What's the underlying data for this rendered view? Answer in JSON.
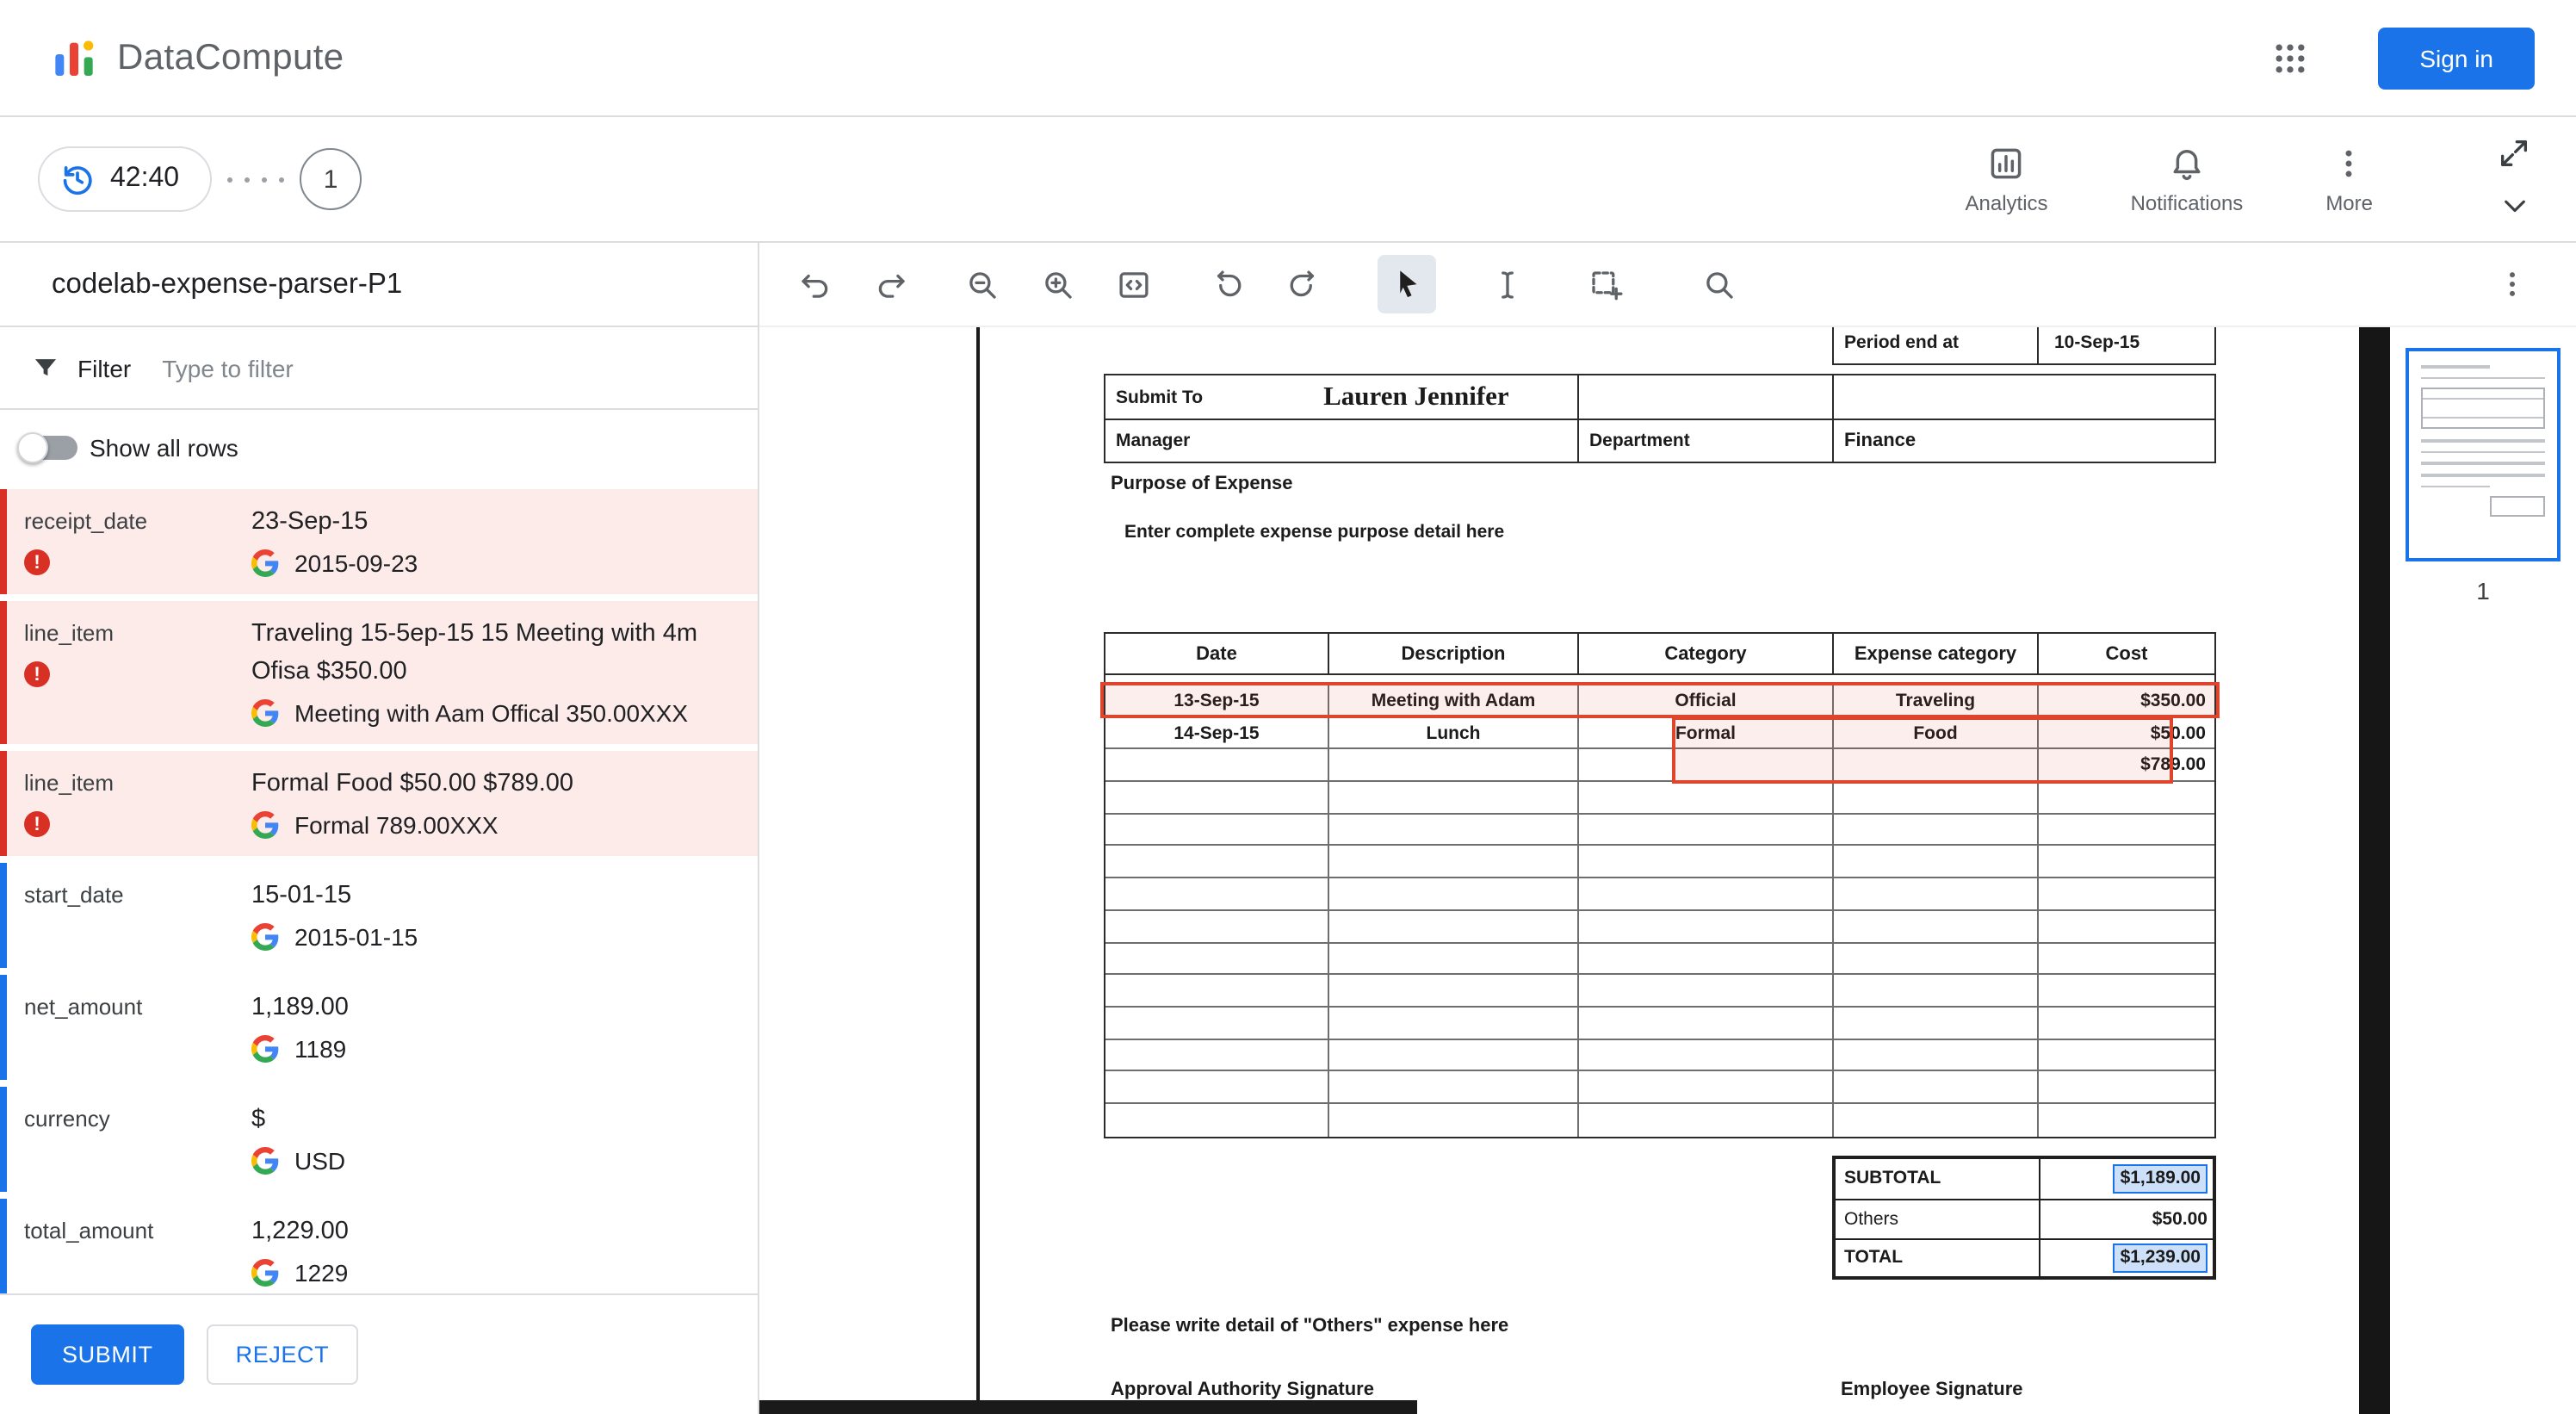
{
  "colors": {
    "accent": "#1a73e8",
    "error": "#d93025",
    "error_bg": "#fcebe9",
    "annotation_red": "#df442d"
  },
  "header": {
    "brand": "DataCompute",
    "sign_in": "Sign in"
  },
  "session_bar": {
    "timer": "42:40",
    "step": "1",
    "actions": [
      {
        "label": "Analytics"
      },
      {
        "label": "Notifications"
      },
      {
        "label": "More"
      }
    ]
  },
  "left_panel": {
    "title": "codelab-expense-parser-P1",
    "filter_label": "Filter",
    "filter_placeholder": "Type to filter",
    "show_all_rows": "Show all rows",
    "fields": [
      {
        "name": "receipt_date",
        "status": "error",
        "value": "23-Sep-15",
        "normalized": "2015-09-23"
      },
      {
        "name": "line_item",
        "status": "error",
        "value": "Traveling 15-5ep-15 15 Meeting with 4m Ofisa $350.00",
        "normalized": "Meeting with Aam Offical 350.00XXX"
      },
      {
        "name": "line_item",
        "status": "error",
        "value": "Formal Food $50.00 $789.00",
        "normalized": "Formal 789.00XXX"
      },
      {
        "name": "start_date",
        "status": "ok",
        "value": "15-01-15",
        "normalized": "2015-01-15"
      },
      {
        "name": "net_amount",
        "status": "ok",
        "value": "1,189.00",
        "normalized": "1189"
      },
      {
        "name": "currency",
        "status": "ok",
        "value": "$",
        "normalized": "USD"
      },
      {
        "name": "total_amount",
        "status": "ok",
        "value": "1,229.00",
        "normalized": "1229"
      }
    ],
    "submit": "SUBMIT",
    "reject": "REJECT"
  },
  "toolbar": {
    "tools": [
      "undo",
      "redo",
      "zoom-out",
      "zoom-in",
      "code-view",
      "rotate-left",
      "rotate-right",
      "select-pointer",
      "text-select",
      "add-region",
      "search"
    ],
    "active_tool": "select-pointer"
  },
  "document": {
    "top_row": {
      "label": "Period end at",
      "value": "10-Sep-15"
    },
    "submit_to_label": "Submit To",
    "submit_to_value": "Lauren Jennifer",
    "manager_label": "Manager",
    "department_label": "Department",
    "department_value": "Finance",
    "purpose_label": "Purpose of Expense",
    "purpose_hint": "Enter complete expense  purpose detail here",
    "table": {
      "headers": [
        "Date",
        "Description",
        "Category",
        "Expense category",
        "Cost"
      ],
      "rows": [
        [
          "13-Sep-15",
          "Meeting with Adam",
          "Official",
          "Traveling",
          "$350.00"
        ],
        [
          "14-Sep-15",
          "Lunch",
          "Formal",
          "Food",
          "$50.00"
        ],
        [
          "",
          "",
          "",
          "",
          "$789.00"
        ]
      ],
      "empty_rows": 11
    },
    "totals": [
      {
        "label": "SUBTOTAL",
        "value": "$1,189.00",
        "highlight": true
      },
      {
        "label": "Others",
        "value": "$50.00",
        "highlight": false
      },
      {
        "label": "TOTAL",
        "value": "$1,239.00",
        "highlight": true
      }
    ],
    "others_hint": "Please write detail of \"Others\" expense here",
    "approval_signature": "Approval Authority Signature",
    "employee_signature": "Employee Signature"
  },
  "thumbnails": {
    "page_number": "1"
  }
}
